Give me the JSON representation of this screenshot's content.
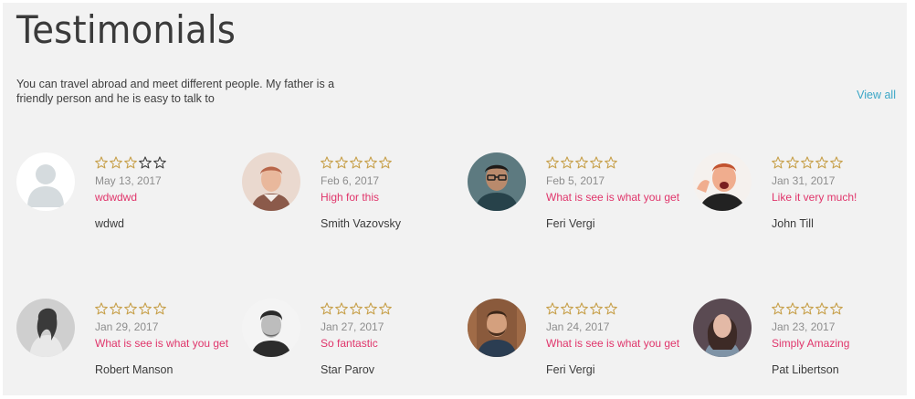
{
  "section": {
    "title": "Testimonials",
    "intro": "You can travel abroad and meet different people. My father is a friendly person and he is easy to talk to",
    "view_all_label": "View all"
  },
  "colors": {
    "star_filled": "#c7a04a",
    "star_empty": "#3c3c3c",
    "headline": "#e0356b",
    "link": "#3aa6c6"
  },
  "testimonials": [
    {
      "rating": 3,
      "date": "May 13, 2017",
      "headline": "wdwdwd",
      "name": "wdwd",
      "avatar": "placeholder-avatar"
    },
    {
      "rating": 5,
      "date": "Feb 6, 2017",
      "headline": "High for this",
      "name": "Smith Vazovsky",
      "avatar": "man-red-hair-photo"
    },
    {
      "rating": 5,
      "date": "Feb 5, 2017",
      "headline": "What is see is what you get",
      "name": "Feri Vergi",
      "avatar": "man-glasses-photo"
    },
    {
      "rating": 5,
      "date": "Jan 31, 2017",
      "headline": "Like it very much!",
      "name": "John Till",
      "avatar": "excited-man-photo"
    },
    {
      "rating": 5,
      "date": "Jan 29, 2017",
      "headline": "What is see is what you get",
      "name": "Robert Manson",
      "avatar": "woman-bw-photo"
    },
    {
      "rating": 5,
      "date": "Jan 27, 2017",
      "headline": "So fantastic",
      "name": "Star Parov",
      "avatar": "man-bw-photo"
    },
    {
      "rating": 5,
      "date": "Jan 24, 2017",
      "headline": "What is see is what you get",
      "name": "Feri Vergi",
      "avatar": "man-beard-photo"
    },
    {
      "rating": 5,
      "date": "Jan 23, 2017",
      "headline": "Simply Amazing",
      "name": "Pat Libertson",
      "avatar": "woman-photo"
    }
  ]
}
